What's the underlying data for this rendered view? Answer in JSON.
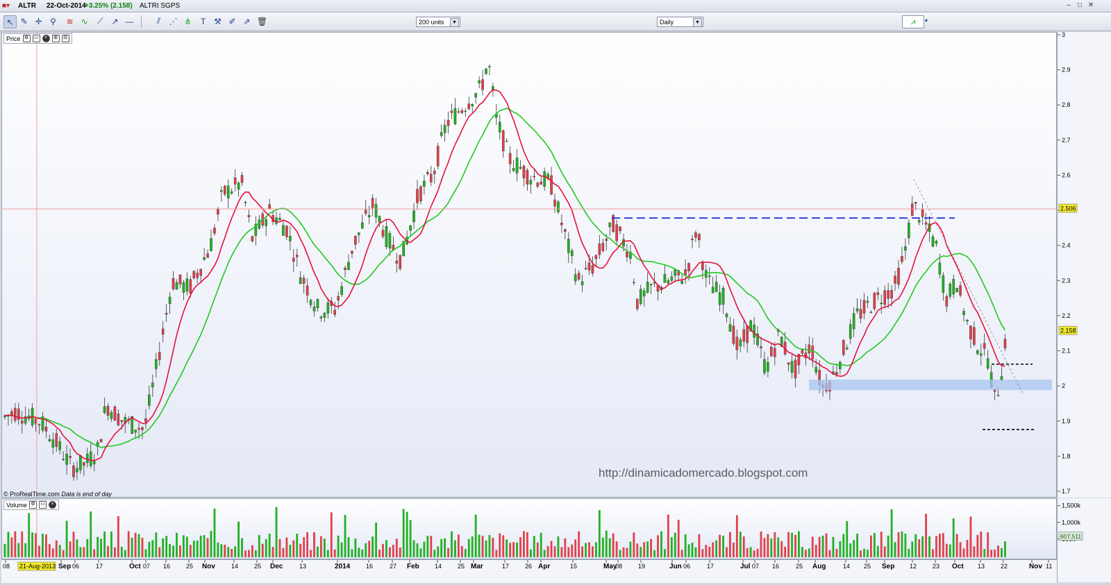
{
  "titlebar": {
    "symbol": "ALTR",
    "date": "22-Oct-2014",
    "change": "+3.25% (2.158)",
    "name": "ALTRI SGPS"
  },
  "toolbar": {
    "units_select": "200 units",
    "period_select": "Daily",
    "icons": [
      "cursor-icon",
      "ruler-icon",
      "crosshair-icon",
      "zoom-icon",
      "fibonacci-icon",
      "wave-icon",
      "trendline-icon",
      "ray-icon",
      "horizontal-line-icon",
      "vertical-line-icon",
      "channel-icon",
      "fan-icon",
      "text-icon",
      "tools-icon",
      "pen-icon",
      "trash-icon"
    ]
  },
  "price_panel": {
    "label": "Price",
    "last_price_tag": "2.158",
    "cursor_price_tag": "2.506",
    "copyright": "© ProRealTime.com",
    "data_note": "Data is end of day",
    "watermark": "http://dinamicadomercado.blogspot.com"
  },
  "volume_panel": {
    "label": "Volume",
    "last_volume_tag": "607,511"
  },
  "x_axis": {
    "cursor_date_tag": "21-Aug-2013"
  },
  "colors": {
    "bull": "#22b022",
    "bear": "#e0404a",
    "ma_fast": "#e8103c",
    "ma_slow": "#22c822",
    "crosshair": "#f08a8a",
    "resistance": "#1f35d8",
    "support_zone": "#a8c6f2",
    "last_tag": "#f2ea2a",
    "cursor_tag": "#f2ea2a",
    "volume_tag": "#d2f0d2"
  },
  "chart_data": {
    "type": "candlestick",
    "ylim": [
      1.7,
      3.0
    ],
    "y_ticks": [
      "3",
      "2.9",
      "2.8",
      "2.7",
      "2.6",
      "2.5",
      "2.4",
      "2.3",
      "2.2",
      "2.1",
      "2",
      "1.9",
      "1.8",
      "1.7"
    ],
    "volume_ticks": [
      "1,500k",
      "1,000k",
      "500k"
    ],
    "x_ticks": [
      "08",
      "Sep",
      "06",
      "17",
      "Oct",
      "07",
      "16",
      "25",
      "Nov",
      "14",
      "25",
      "Dec",
      "13",
      "2014",
      "16",
      "27",
      "Feb",
      "14",
      "25",
      "Mar",
      "17",
      "26",
      "Apr",
      "15",
      "May",
      "08",
      "19",
      "Jun",
      "06",
      "17",
      "Jul",
      "07",
      "16",
      "25",
      "Aug",
      "14",
      "25",
      "Sep",
      "12",
      "23",
      "Oct",
      "13",
      "22",
      "Nov",
      "11"
    ],
    "candles_summary": "Daily OHLC from Aug-2013 to 22-Oct-2014, range 1.74 to 2.94",
    "ma_fast_label": "",
    "ma_slow_label": "",
    "key_levels": [
      {
        "kind": "resistance",
        "value": 2.48
      },
      {
        "kind": "support-zone",
        "from": 1.99,
        "to": 2.02
      },
      {
        "kind": "upper-dotted",
        "value": 2.064
      },
      {
        "kind": "lower-dotted",
        "value": 1.878
      }
    ],
    "last_close": 2.158,
    "last_volume": 607511
  }
}
